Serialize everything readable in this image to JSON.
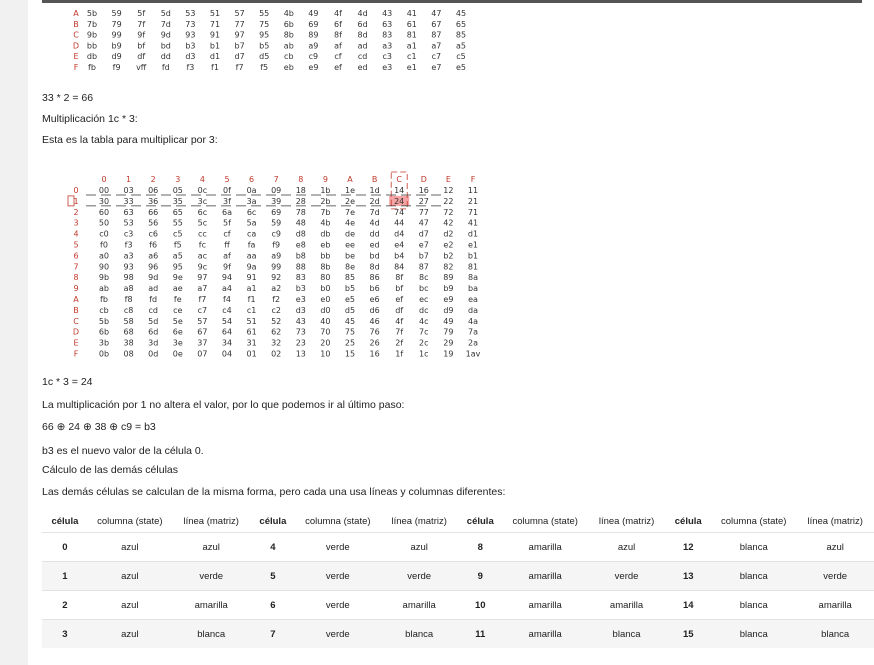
{
  "top_table": {
    "rows": [
      {
        "label": "A",
        "cells": [
          "5b",
          "59",
          "5f",
          "5d",
          "53",
          "51",
          "57",
          "55",
          "4b",
          "49",
          "4f",
          "4d",
          "43",
          "41",
          "47",
          "45"
        ]
      },
      {
        "label": "B",
        "cells": [
          "7b",
          "79",
          "7f",
          "7d",
          "73",
          "71",
          "77",
          "75",
          "6b",
          "69",
          "6f",
          "6d",
          "63",
          "61",
          "67",
          "65"
        ]
      },
      {
        "label": "C",
        "cells": [
          "9b",
          "99",
          "9f",
          "9d",
          "93",
          "91",
          "97",
          "95",
          "8b",
          "89",
          "8f",
          "8d",
          "83",
          "81",
          "87",
          "85"
        ]
      },
      {
        "label": "D",
        "cells": [
          "bb",
          "b9",
          "bf",
          "bd",
          "b3",
          "b1",
          "b7",
          "b5",
          "ab",
          "a9",
          "af",
          "ad",
          "a3",
          "a1",
          "a7",
          "a5"
        ]
      },
      {
        "label": "E",
        "cells": [
          "db",
          "d9",
          "df",
          "dd",
          "d3",
          "d1",
          "d7",
          "d5",
          "cb",
          "c9",
          "cf",
          "cd",
          "c3",
          "c1",
          "c7",
          "c5"
        ]
      },
      {
        "label": "F",
        "cells": [
          "fb",
          "f9",
          "vff",
          "fd",
          "f3",
          "f1",
          "f7",
          "f5",
          "eb",
          "e9",
          "ef",
          "ed",
          "e3",
          "e1",
          "e7",
          "e5"
        ]
      }
    ]
  },
  "texts": {
    "eq1": "33 * 2 = 66",
    "heading_mult": "Multiplicación 1c * 3:",
    "intro": "Esta es la tabla para multiplicar por 3:",
    "eq2": "1c * 3 = 24",
    "note": "La multiplicación por 1 no altera el valor, por lo que podemos ir al último paso:",
    "xor_parts": [
      "66",
      "24",
      "38",
      "c9 = b3"
    ],
    "xor_symbol": "⊕",
    "new_value": "b3 es el nuevo valor de la célula 0.",
    "heading_calc": "Cálculo de las demás células",
    "calc_desc": "Las demás células se calculan de la misma forma, pero cada una usa líneas y columnas diferentes:"
  },
  "mult_table": {
    "col_headers": [
      "0",
      "1",
      "2",
      "3",
      "4",
      "5",
      "6",
      "7",
      "8",
      "9",
      "A",
      "B",
      "C",
      "D",
      "E",
      "F"
    ],
    "highlight_col": 12,
    "highlight_row": 1,
    "rows": [
      {
        "label": "0",
        "cells": [
          "00",
          "03",
          "06",
          "05",
          "0c",
          "0f",
          "0a",
          "09",
          "18",
          "1b",
          "1e",
          "1d",
          "14",
          "16",
          "12",
          "11"
        ]
      },
      {
        "label": "1",
        "cells": [
          "30",
          "33",
          "36",
          "35",
          "3c",
          "3f",
          "3a",
          "39",
          "28",
          "2b",
          "2e",
          "2d",
          "24",
          "27",
          "22",
          "21"
        ]
      },
      {
        "label": "2",
        "cells": [
          "60",
          "63",
          "66",
          "65",
          "6c",
          "6a",
          "6c",
          "69",
          "78",
          "7b",
          "7e",
          "7d",
          "74",
          "77",
          "72",
          "71"
        ]
      },
      {
        "label": "3",
        "cells": [
          "50",
          "53",
          "56",
          "55",
          "5c",
          "5f",
          "5a",
          "59",
          "48",
          "4b",
          "4e",
          "4d",
          "44",
          "47",
          "42",
          "41"
        ]
      },
      {
        "label": "4",
        "cells": [
          "c0",
          "c3",
          "c6",
          "c5",
          "cc",
          "cf",
          "ca",
          "c9",
          "d8",
          "db",
          "de",
          "dd",
          "d4",
          "d7",
          "d2",
          "d1"
        ]
      },
      {
        "label": "5",
        "cells": [
          "f0",
          "f3",
          "f6",
          "f5",
          "fc",
          "ff",
          "fa",
          "f9",
          "e8",
          "eb",
          "ee",
          "ed",
          "e4",
          "e7",
          "e2",
          "e1"
        ]
      },
      {
        "label": "6",
        "cells": [
          "a0",
          "a3",
          "a6",
          "a5",
          "ac",
          "af",
          "aa",
          "a9",
          "b8",
          "bb",
          "be",
          "bd",
          "b4",
          "b7",
          "b2",
          "b1"
        ]
      },
      {
        "label": "7",
        "cells": [
          "90",
          "93",
          "96",
          "95",
          "9c",
          "9f",
          "9a",
          "99",
          "88",
          "8b",
          "8e",
          "8d",
          "84",
          "87",
          "82",
          "81"
        ]
      },
      {
        "label": "8",
        "cells": [
          "9b",
          "98",
          "9d",
          "9e",
          "97",
          "94",
          "91",
          "92",
          "83",
          "80",
          "85",
          "86",
          "8f",
          "8c",
          "89",
          "8a"
        ]
      },
      {
        "label": "9",
        "cells": [
          "ab",
          "a8",
          "ad",
          "ae",
          "a7",
          "a4",
          "a1",
          "a2",
          "b3",
          "b0",
          "b5",
          "b6",
          "bf",
          "bc",
          "b9",
          "ba"
        ]
      },
      {
        "label": "A",
        "cells": [
          "fb",
          "f8",
          "fd",
          "fe",
          "f7",
          "f4",
          "f1",
          "f2",
          "e3",
          "e0",
          "e5",
          "e6",
          "ef",
          "ec",
          "e9",
          "ea"
        ]
      },
      {
        "label": "B",
        "cells": [
          "cb",
          "c8",
          "cd",
          "ce",
          "c7",
          "c4",
          "c1",
          "c2",
          "d3",
          "d0",
          "d5",
          "d6",
          "df",
          "dc",
          "d9",
          "da"
        ]
      },
      {
        "label": "C",
        "cells": [
          "5b",
          "58",
          "5d",
          "5e",
          "57",
          "54",
          "51",
          "52",
          "43",
          "40",
          "45",
          "46",
          "4f",
          "4c",
          "49",
          "4a"
        ]
      },
      {
        "label": "D",
        "cells": [
          "6b",
          "68",
          "6d",
          "6e",
          "67",
          "64",
          "61",
          "62",
          "73",
          "70",
          "75",
          "76",
          "7f",
          "7c",
          "79",
          "7a"
        ]
      },
      {
        "label": "E",
        "cells": [
          "3b",
          "38",
          "3d",
          "3e",
          "37",
          "34",
          "31",
          "32",
          "23",
          "20",
          "25",
          "26",
          "2f",
          "2c",
          "29",
          "2a"
        ]
      },
      {
        "label": "F",
        "cells": [
          "0b",
          "08",
          "0d",
          "0e",
          "07",
          "04",
          "01",
          "02",
          "13",
          "10",
          "15",
          "16",
          "1f",
          "1c",
          "19",
          "1av"
        ]
      }
    ]
  },
  "cells_table": {
    "headers": [
      "célula",
      "columna (state)",
      "línea (matriz)",
      "célula",
      "columna (state)",
      "línea (matriz)",
      "célula",
      "columna (state)",
      "línea (matriz)",
      "célula",
      "columna (state)",
      "línea (matriz)"
    ],
    "rows": [
      [
        "0",
        "azul",
        "azul",
        "4",
        "verde",
        "azul",
        "8",
        "amarilla",
        "azul",
        "12",
        "blanca",
        "azul"
      ],
      [
        "1",
        "azul",
        "verde",
        "5",
        "verde",
        "verde",
        "9",
        "amarilla",
        "verde",
        "13",
        "blanca",
        "verde"
      ],
      [
        "2",
        "azul",
        "amarilla",
        "6",
        "verde",
        "amarilla",
        "10",
        "amarilla",
        "amarilla",
        "14",
        "blanca",
        "amarilla"
      ],
      [
        "3",
        "azul",
        "blanca",
        "7",
        "verde",
        "blanca",
        "11",
        "amarilla",
        "blanca",
        "15",
        "blanca",
        "blanca"
      ]
    ]
  },
  "colors": {
    "label_red": "#c0392b",
    "highlight_fill": "#f5a3a3",
    "highlight_border": "#c0392b"
  }
}
